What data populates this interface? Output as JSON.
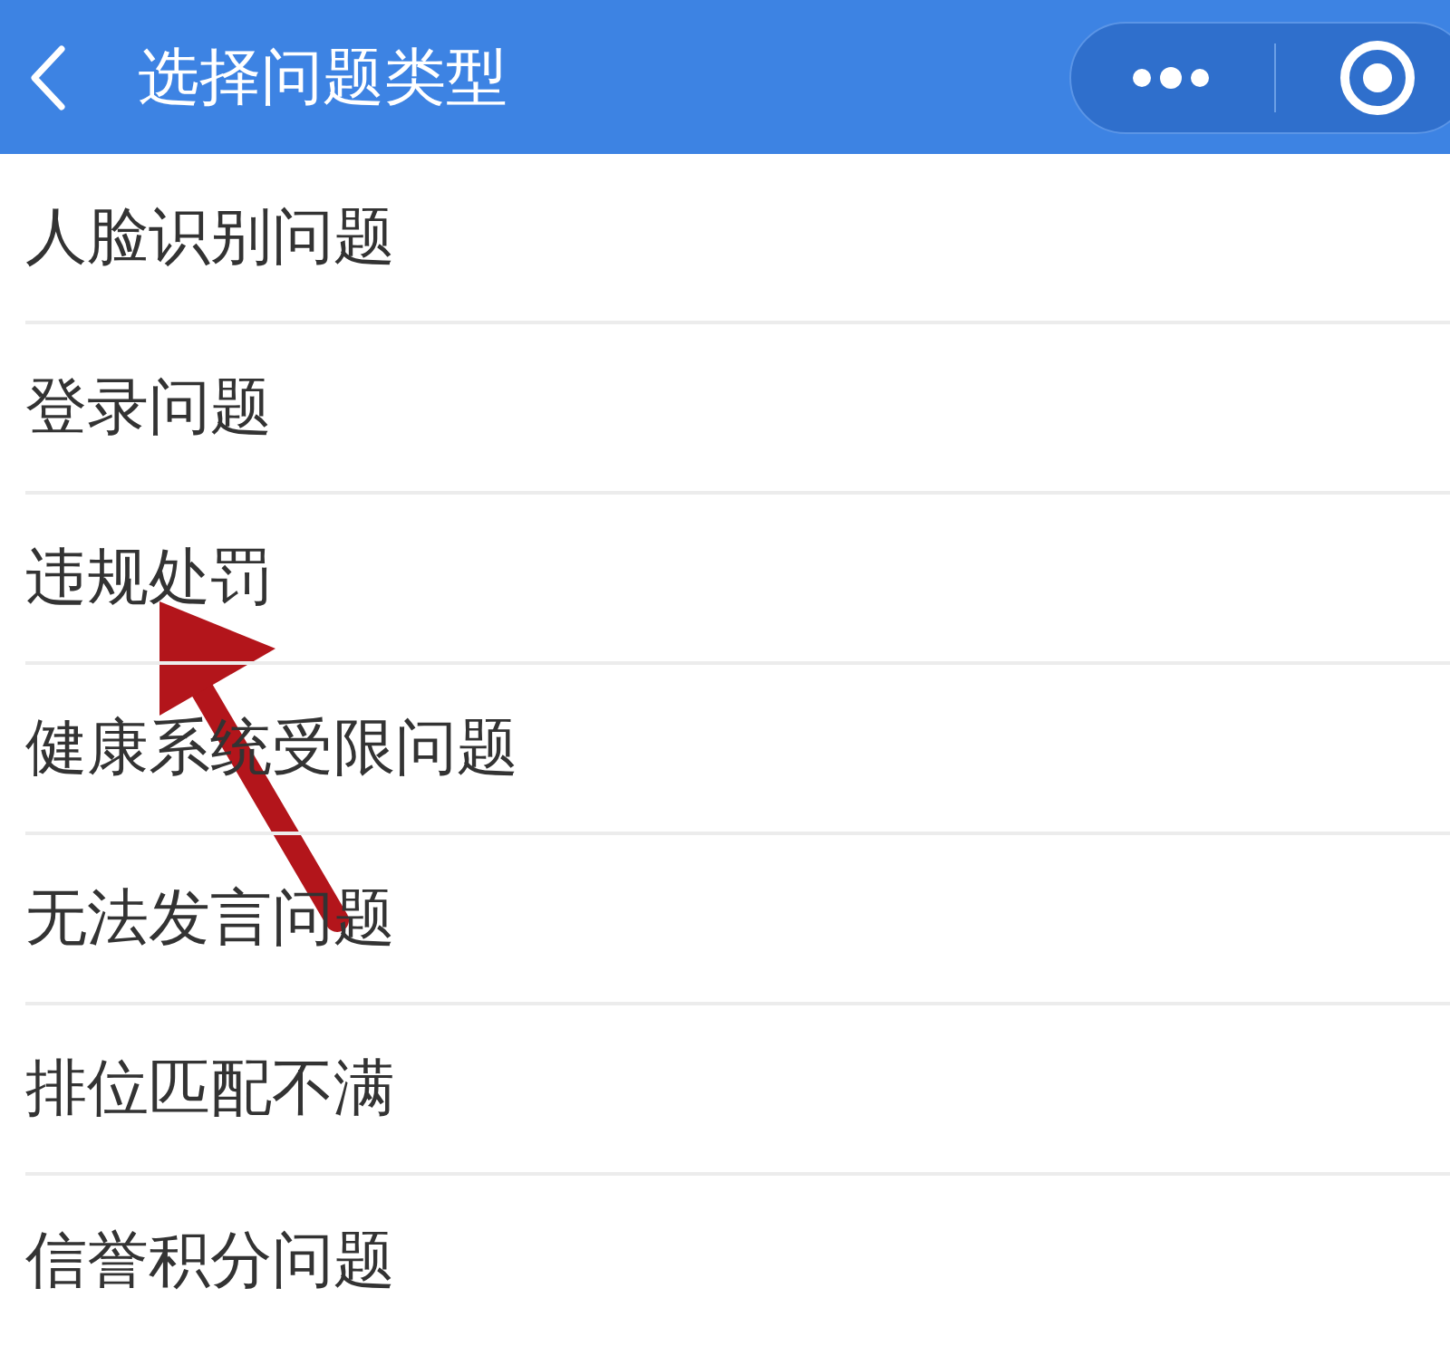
{
  "header": {
    "title": "选择问题类型"
  },
  "items": [
    {
      "label": "人脸识别问题"
    },
    {
      "label": "登录问题"
    },
    {
      "label": "违规处罚"
    },
    {
      "label": "健康系统受限问题"
    },
    {
      "label": "无法发言问题"
    },
    {
      "label": "排位匹配不满"
    },
    {
      "label": "信誉积分问题"
    }
  ]
}
